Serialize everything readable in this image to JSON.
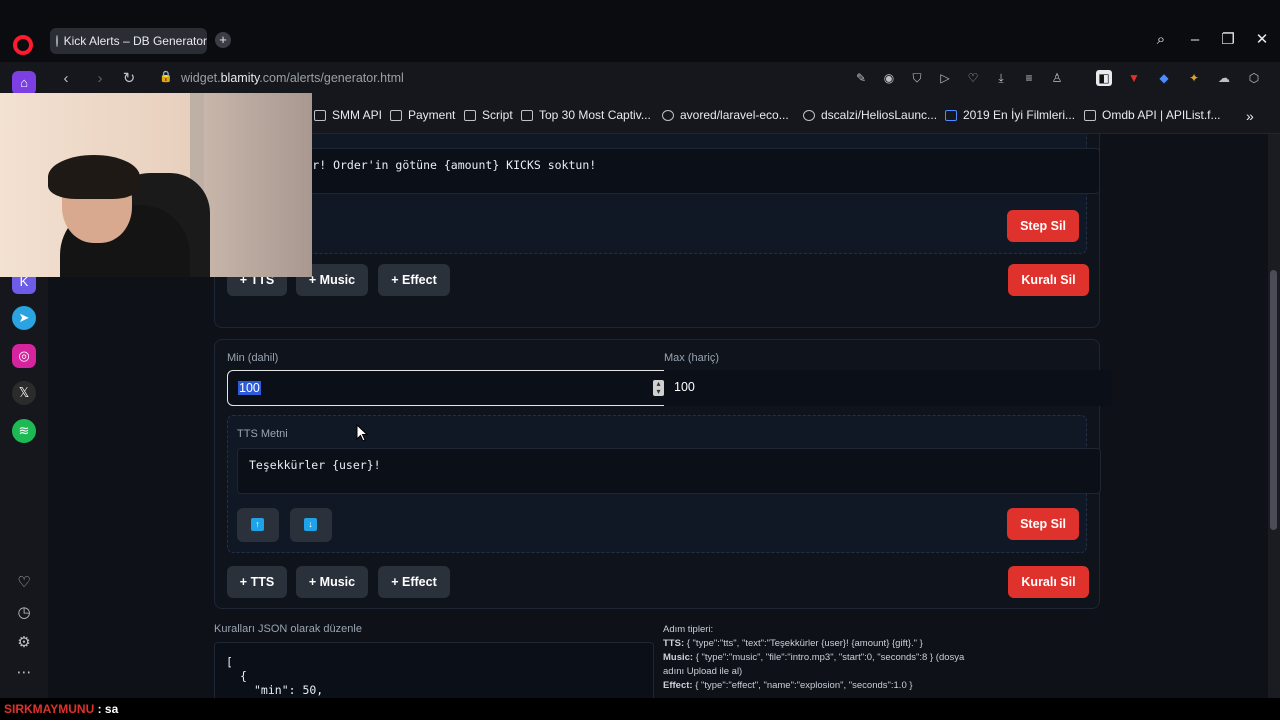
{
  "browser": {
    "tab_title": "Kick Alerts – DB Generator",
    "url_prefix": "widget.",
    "url_host": "blamity",
    "url_rest": ".com/alerts/generator.html",
    "bookmarks": [
      "SMM API",
      "Payment",
      "Script",
      "Top 30 Most Captiv...",
      "avored/laravel-eco...",
      "dscalzi/HeliosLaunc...",
      "2019 En İyi Filmleri...",
      "Omdb API | APIList.f..."
    ]
  },
  "rule1": {
    "tts_text": "Teşekkürler! Order'in götüne {amount} KICKS soktun!",
    "tts_text_visible": "eşekkürler! Order'in götüne {amount} KICKS soktun!",
    "step_delete": "Step Sil",
    "add_tts": "+ TTS",
    "add_music": "+ Music",
    "add_effect": "+ Effect",
    "rule_delete": "Kuralı Sil"
  },
  "rule2": {
    "min_label": "Min (dahil)",
    "max_label": "Max (hariç)",
    "min_value": "100",
    "max_value": "100",
    "tts_label": "TTS Metni",
    "tts_text": "Teşekkürler {user}!",
    "step_delete": "Step Sil",
    "add_tts": "+ TTS",
    "add_music": "+ Music",
    "add_effect": "+ Effect",
    "rule_delete": "Kuralı Sil"
  },
  "json_editor": {
    "label": "Kuralları JSON olarak düzenle",
    "line1": "[",
    "line2": "{",
    "line3": "\"min\": 50,"
  },
  "step_types": {
    "title": "Adım tipleri:",
    "tts_key": "TTS:",
    "tts_val": "{ \"type\":\"tts\", \"text\":\"Teşekkürler {user}! {amount} {gift}.\" }",
    "music_key": "Music:",
    "music_val": "{ \"type\":\"music\", \"file\":\"intro.mp3\", \"start\":0, \"seconds\":8 } (dosya",
    "music_val2": "adını Upload ile al)",
    "effect_key": "Effect:",
    "effect_val": "{ \"type\":\"effect\", \"name\":\"explosion\", \"seconds\":1.0 }"
  },
  "chat": {
    "user": "SIRKMAYMUNU",
    "message": " : sa"
  },
  "colors": {
    "danger": "#e0322d",
    "accent_blue": "#1fa3e8",
    "page_bg": "#0e1117"
  }
}
